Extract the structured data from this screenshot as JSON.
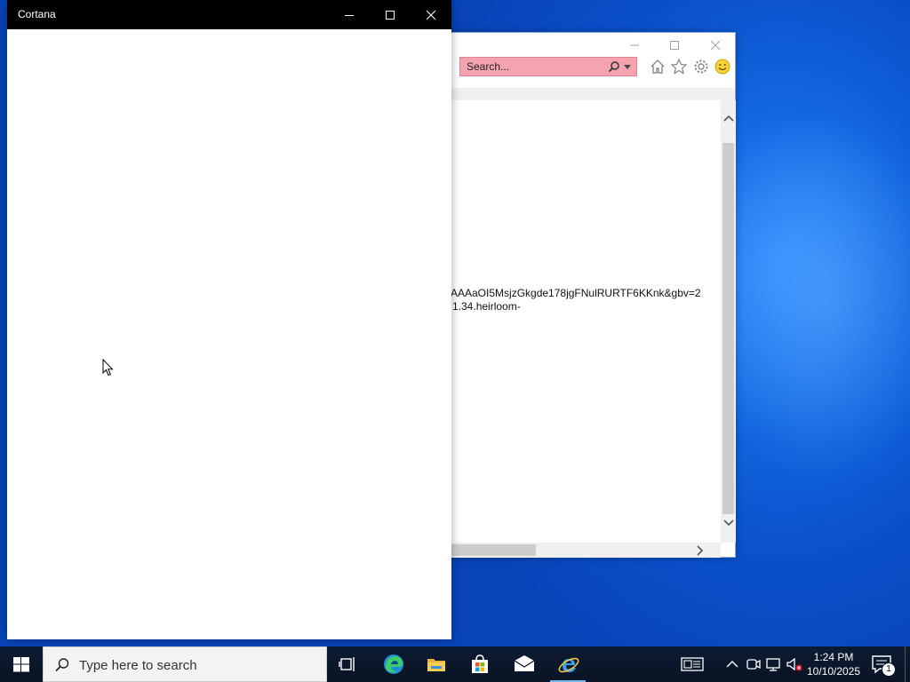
{
  "cortana_window": {
    "title": "Cortana",
    "controls": [
      "minimize",
      "maximize",
      "close"
    ]
  },
  "ie_window": {
    "search_placeholder": "Search...",
    "content_lines": [
      "AAAaOI5MsjzGkgde178jgFNulRURTF6KKnk&gbv=2",
      "1.34.heirloom-"
    ],
    "search_color": "#f5a3ae"
  },
  "taskbar": {
    "search_placeholder": "Type here to search",
    "clock_time": "1:24 PM",
    "clock_date": "10/10/2025",
    "notification_count": "1",
    "pinned_apps": [
      "task-view-icon",
      "edge-icon",
      "file-explorer-icon",
      "store-icon",
      "mail-icon",
      "internet-explorer-icon"
    ]
  },
  "colors": {
    "desktop": "#0a4fc9",
    "taskbar": "#0a1424",
    "cortana_titlebar": "#000000"
  }
}
